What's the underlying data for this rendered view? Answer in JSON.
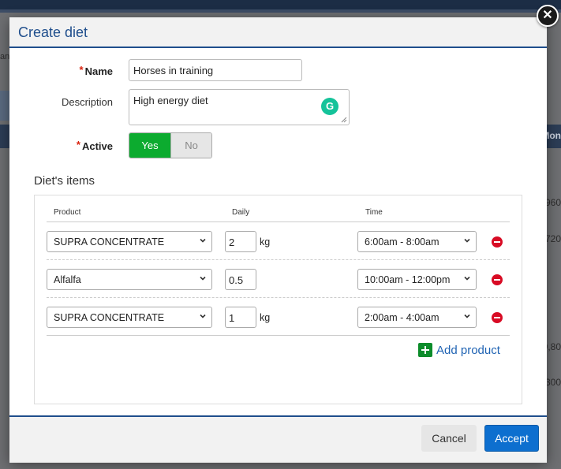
{
  "background": {
    "header_fragment": "Mon",
    "left_fragment": "an",
    "cell_fragments": [
      "960",
      "720",
      "9,80",
      "300"
    ]
  },
  "modal": {
    "title": "Create diet",
    "close_symbol": "✕",
    "form": {
      "required_mark": "*",
      "name_label": "Name",
      "name_value": "Horses in training",
      "description_label": "Description",
      "description_value": "High energy diet",
      "grammarly_symbol": "G",
      "active_label": "Active",
      "active_yes": "Yes",
      "active_no": "No",
      "active_selected": "Yes"
    },
    "items_section": {
      "title": "Diet's items",
      "columns": {
        "product": "Product",
        "daily": "Daily",
        "time": "Time"
      },
      "rows": [
        {
          "product": "SUPRA CONCENTRATE",
          "quantity": "2",
          "unit": "kg",
          "time": "6:00am - 8:00am"
        },
        {
          "product": "Alfalfa",
          "quantity": "0.5",
          "unit": "",
          "time": "10:00am - 12:00pm"
        },
        {
          "product": "SUPRA CONCENTRATE",
          "quantity": "1",
          "unit": "kg",
          "time": "2:00am - 4:00am"
        }
      ],
      "add_label": "Add product"
    },
    "footer": {
      "cancel_label": "Cancel",
      "accept_label": "Accept"
    }
  },
  "colors": {
    "accent": "#1f4e8c",
    "toggle_on": "#0cab2f",
    "remove": "#d80b24",
    "add": "#0d8c2b",
    "primary_button": "#0d6fcf"
  },
  "icons": [
    "close-icon",
    "grammarly-icon",
    "chevron-down-icon",
    "remove-icon",
    "add-icon"
  ]
}
